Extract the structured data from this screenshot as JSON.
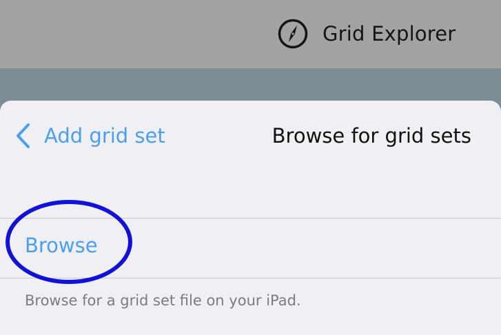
{
  "header": {
    "app_title": "Grid Explorer",
    "icon": "compass-icon"
  },
  "sheet": {
    "back_label": "Add grid set",
    "back_icon": "chevron-left-icon",
    "title": "Browse for grid sets",
    "browse_label": "Browse",
    "footer_note": "Browse for a grid set file on your iPad."
  },
  "colors": {
    "accent": "#4a9ff0",
    "highlight_ring": "#1212d6",
    "topbar": "#a3a3a3",
    "sheet_background": "#efeff4"
  }
}
